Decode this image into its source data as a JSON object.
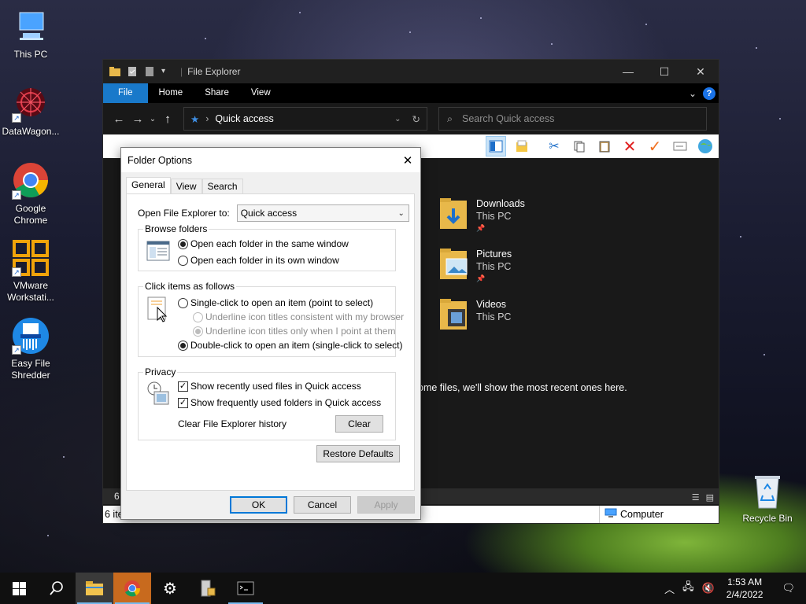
{
  "desktop": {
    "icons": [
      {
        "label": "This PC",
        "icon": "computer-icon"
      },
      {
        "label": "DataWagon...",
        "icon": "datawagon-icon"
      },
      {
        "label": "Google Chrome",
        "icon": "chrome-icon"
      },
      {
        "label": "VMware Workstati...",
        "icon": "vmware-icon"
      },
      {
        "label": "Easy File Shredder",
        "icon": "shredder-icon"
      },
      {
        "label": "Recycle Bin",
        "icon": "recycle-bin-icon"
      }
    ]
  },
  "explorer": {
    "title": "File Explorer",
    "tabs": [
      "File",
      "Home",
      "Share",
      "View"
    ],
    "address": "Quick access",
    "search_placeholder": "Search Quick access",
    "quick_access": [
      {
        "name": "Downloads",
        "location": "This PC"
      },
      {
        "name": "Pictures",
        "location": "This PC"
      },
      {
        "name": "Videos",
        "location": "This PC"
      }
    ],
    "recent_message": "ome files, we'll show the most recent ones here.",
    "status_count": "6",
    "status_items": "6 ite",
    "status_location": "Computer"
  },
  "dialog": {
    "title": "Folder Options",
    "tabs": [
      "General",
      "View",
      "Search"
    ],
    "open_label": "Open File Explorer to:",
    "open_value": "Quick access",
    "browse_group": "Browse folders",
    "browse_same": "Open each folder in the same window",
    "browse_own": "Open each folder in its own window",
    "click_group": "Click items as follows",
    "single_click": "Single-click to open an item (point to select)",
    "underline_consistent": "Underline icon titles consistent with my browser",
    "underline_point": "Underline icon titles only when I point at them",
    "double_click": "Double-click to open an item (single-click to select)",
    "privacy_group": "Privacy",
    "recent_files": "Show recently used files in Quick access",
    "frequent_folders": "Show frequently used folders in Quick access",
    "clear_history_label": "Clear File Explorer history",
    "clear_button": "Clear",
    "restore_button": "Restore Defaults",
    "ok_button": "OK",
    "cancel_button": "Cancel",
    "apply_button": "Apply"
  },
  "taskbar": {
    "time": "1:53 AM",
    "date": "2/4/2022"
  }
}
